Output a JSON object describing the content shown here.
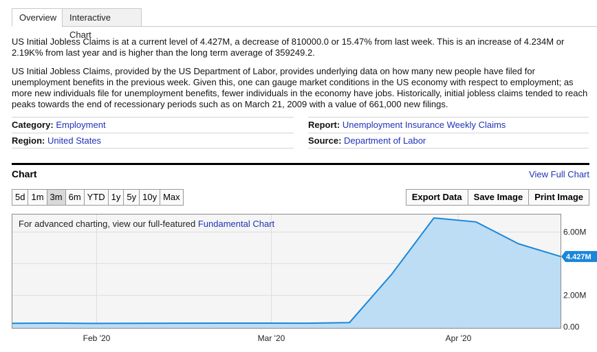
{
  "tabs": [
    {
      "label": "Overview",
      "active": true
    },
    {
      "label": "Interactive Chart",
      "active": false
    }
  ],
  "summary": "US Initial Jobless Claims is at a current level of 4.427M, a decrease of 810000.0 or 15.47% from last week. This is an increase of 4.234M or 2.19K% from last year and is higher than the long term average of 359249.2.",
  "description": "US Initial Jobless Claims, provided by the US Department of Labor, provides underlying data on how many new people have filed for unemployment benefits in the previous week. Given this, one can gauge market conditions in the US economy with respect to employment; as more new individuals file for unemployment benefits, fewer individuals in the economy have jobs. Historically, initial jobless claims tended to reach peaks towards the end of recessionary periods such as on March 21, 2009 with a value of 661,000 new filings.",
  "meta": {
    "category": {
      "label": "Category:",
      "value": "Employment"
    },
    "region": {
      "label": "Region:",
      "value": "United States"
    },
    "report": {
      "label": "Report:",
      "value": "Unemployment Insurance Weekly Claims"
    },
    "source": {
      "label": "Source:",
      "value": "Department of Labor"
    }
  },
  "chart_section": {
    "title": "Chart",
    "view_full": "View Full Chart",
    "ranges": [
      {
        "label": "5d",
        "active": false
      },
      {
        "label": "1m",
        "active": false
      },
      {
        "label": "3m",
        "active": true
      },
      {
        "label": "6m",
        "active": false
      },
      {
        "label": "YTD",
        "active": false
      },
      {
        "label": "1y",
        "active": false
      },
      {
        "label": "5y",
        "active": false
      },
      {
        "label": "10y",
        "active": false
      },
      {
        "label": "Max",
        "active": false
      }
    ],
    "actions": [
      "Export Data",
      "Save Image",
      "Print Image"
    ],
    "advanced_prefix": "For advanced charting, view our full-featured ",
    "advanced_link": "Fundamental Chart"
  },
  "colors": {
    "line": "#1a86d9",
    "fill": "#b8dbf2",
    "plot_bg": "#f5f5f5",
    "grid": "#dedede",
    "link": "#1f33b8"
  },
  "chart_data": {
    "type": "area",
    "title": "US Initial Jobless Claims",
    "xlabel": "",
    "ylabel": "",
    "x": [
      "2020-01-18",
      "2020-01-25",
      "2020-02-01",
      "2020-02-08",
      "2020-02-15",
      "2020-02-22",
      "2020-02-29",
      "2020-03-07",
      "2020-03-14",
      "2020-03-21",
      "2020-03-28",
      "2020-04-04",
      "2020-04-11",
      "2020-04-18"
    ],
    "series": [
      {
        "name": "US Initial Jobless Claims",
        "values": [
          0.21,
          0.216,
          0.202,
          0.205,
          0.211,
          0.219,
          0.217,
          0.211,
          0.251,
          3.307,
          6.867,
          6.615,
          5.237,
          4.427
        ]
      }
    ],
    "x_ticks": [
      {
        "label": "Feb '20",
        "date": "2020-02-01"
      },
      {
        "label": "Mar '20",
        "date": "2020-03-01"
      },
      {
        "label": "Apr '20",
        "date": "2020-04-01"
      }
    ],
    "y_ticks": [
      {
        "value": 0,
        "label": "0.00"
      },
      {
        "value": 2,
        "label": "2.00M"
      },
      {
        "value": 4,
        "label": ""
      },
      {
        "value": 6,
        "label": "6.00M"
      }
    ],
    "ylim": [
      0,
      7.3
    ],
    "units": "millions",
    "last_value_label": "4.427M",
    "grid": true,
    "legend": "none"
  }
}
